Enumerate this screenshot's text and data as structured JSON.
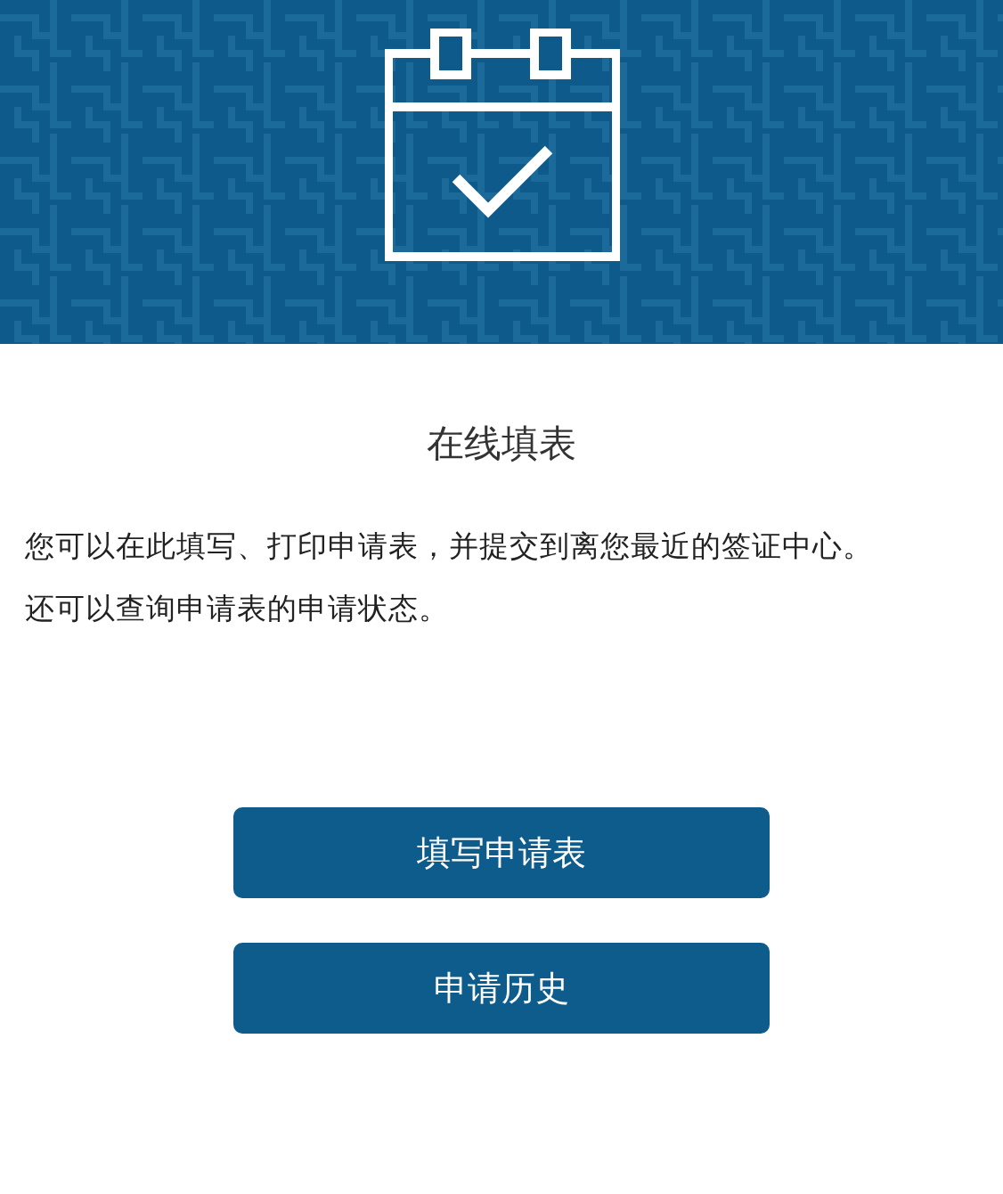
{
  "title": "在线填表",
  "description": [
    "您可以在此填写、打印申请表，并提交到离您最近的签证中心。",
    "还可以查询申请表的申请状态。"
  ],
  "buttons": [
    "填写申请表",
    "申请历史"
  ]
}
